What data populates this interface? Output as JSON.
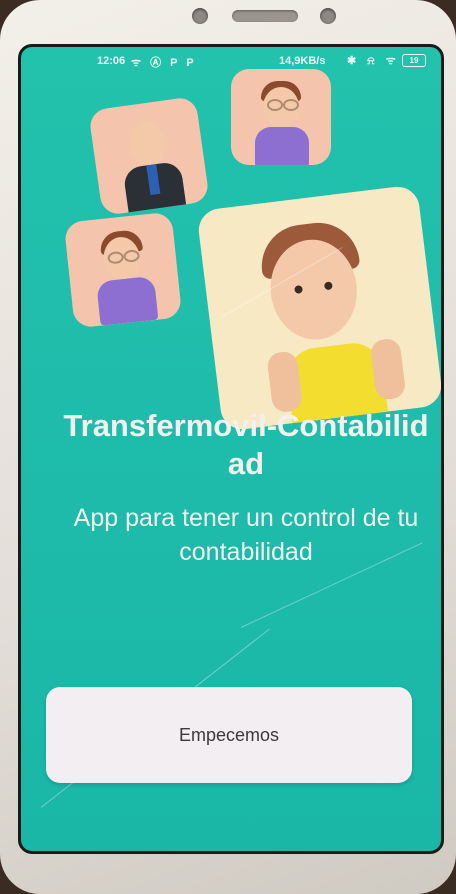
{
  "status_bar": {
    "time": "12:06",
    "left_icons": "ᯤ Ⓐ P P",
    "network_speed": "14,9KB/s",
    "right_icons": "✱ ⍾ ᯤ",
    "battery": "19"
  },
  "onboarding": {
    "title": "Transfermovil-Contabilidad",
    "subtitle": "App para tener un control de tu contabilidad",
    "cta_label": "Empecemos"
  },
  "illustrations": [
    {
      "name": "avatar-man-suit",
      "color": "#f4c4ad"
    },
    {
      "name": "avatar-woman-glasses-top",
      "color": "#f4c4ad"
    },
    {
      "name": "avatar-woman-glasses-left",
      "color": "#f4c4ad"
    },
    {
      "name": "avatar-man-yellow-shirt",
      "color": "#f7e9c4"
    }
  ],
  "colors": {
    "screen_background": "#1fbcab",
    "text": "#f3f1ee",
    "button_background": "#f2eef1"
  }
}
